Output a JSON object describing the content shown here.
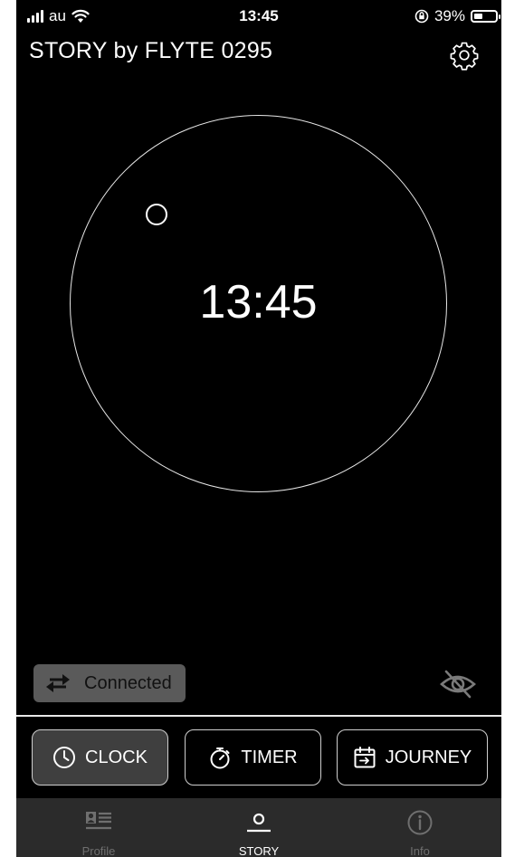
{
  "status": {
    "carrier": "au",
    "time": "13:45",
    "battery": "39%"
  },
  "header": {
    "title": "STORY by FLYTE 0295"
  },
  "clock": {
    "time": "13:45"
  },
  "connection": {
    "label": "Connected"
  },
  "modes": [
    {
      "label": "CLOCK",
      "icon": "clock-icon",
      "active": true
    },
    {
      "label": "TIMER",
      "icon": "stopwatch-icon",
      "active": false
    },
    {
      "label": "JOURNEY",
      "icon": "calendar-icon",
      "active": false
    }
  ],
  "tabs": [
    {
      "label": "Profile",
      "icon": "profile-card-icon",
      "active": false
    },
    {
      "label": "STORY",
      "icon": "story-icon",
      "active": true
    },
    {
      "label": "Info",
      "icon": "info-icon",
      "active": false
    }
  ],
  "colors": {
    "background": "#000000",
    "tabbar": "#2b2b2b",
    "tab_inactive": "#6f6f6f",
    "tab_active": "#ffffff",
    "connected_bg": "#5a5a5a"
  }
}
